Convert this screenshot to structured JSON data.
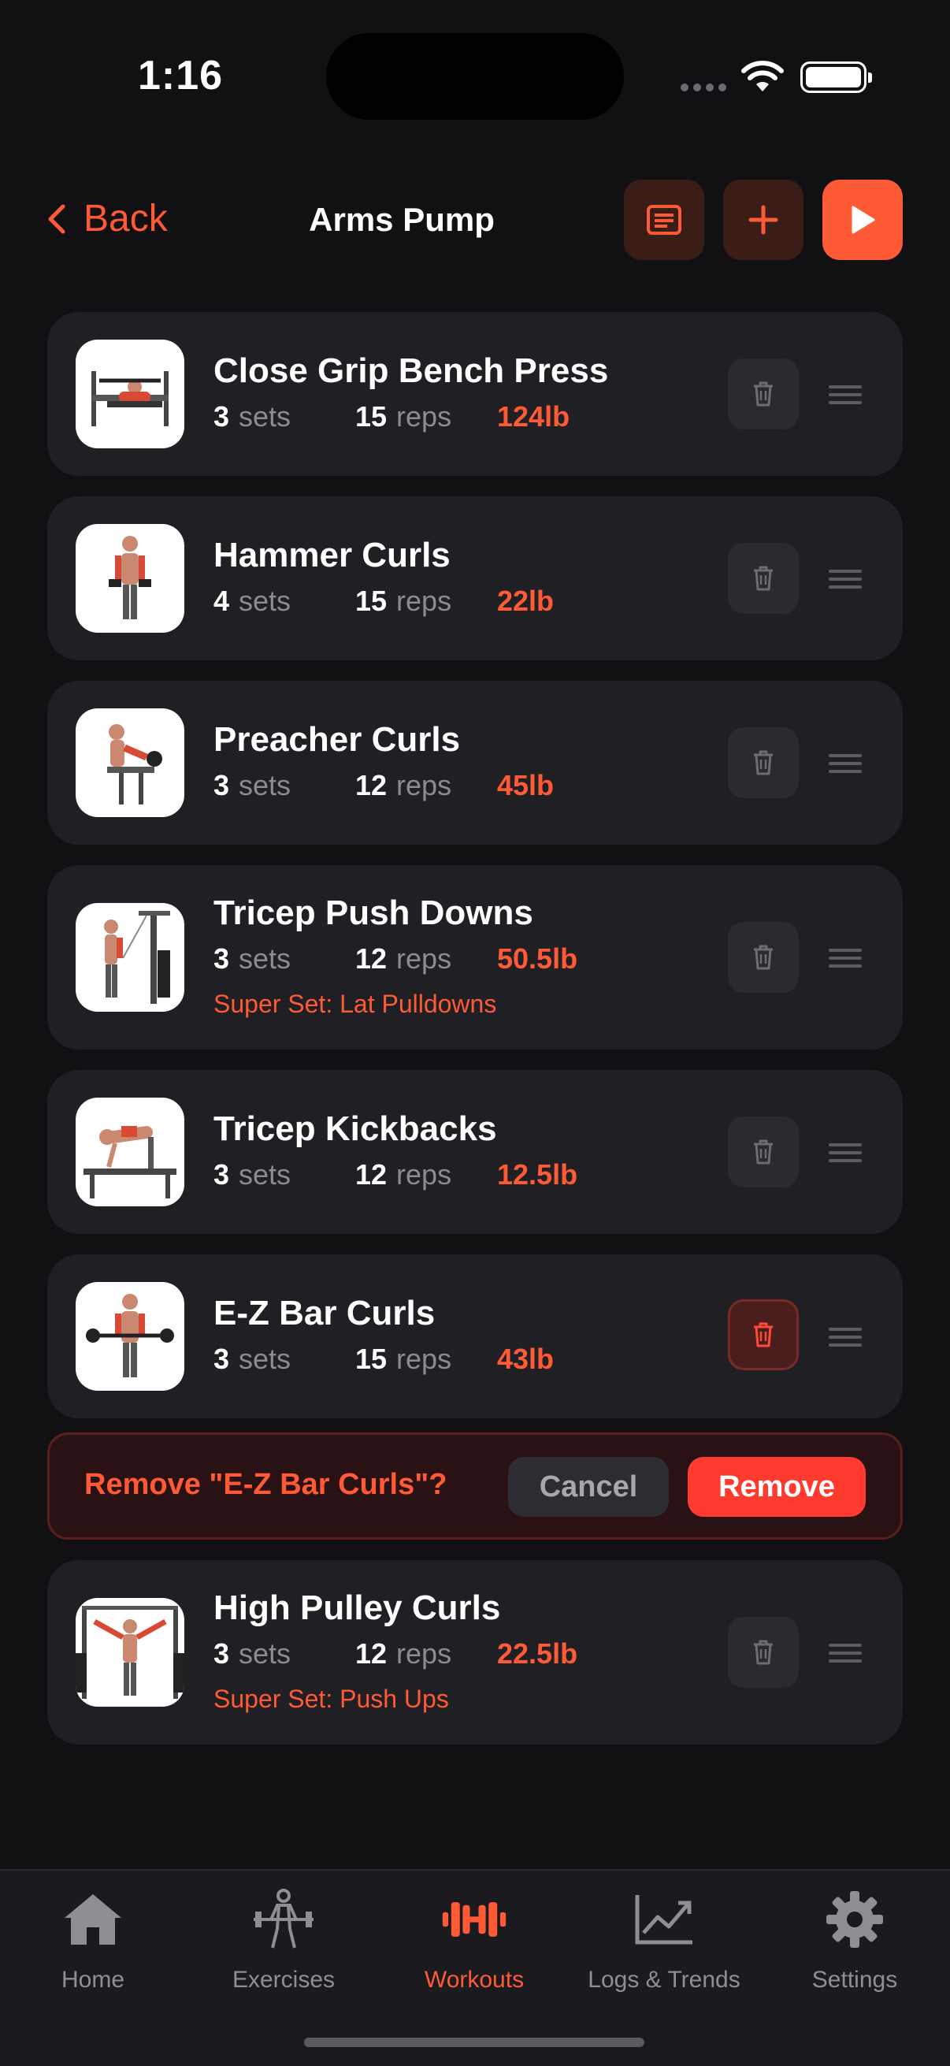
{
  "status_bar": {
    "time": "1:16"
  },
  "nav": {
    "back_label": "Back",
    "title": "Arms Pump",
    "notes_icon": "notes-icon",
    "add_icon": "plus-icon",
    "play_icon": "play-icon"
  },
  "labels": {
    "sets": "sets",
    "reps": "reps"
  },
  "exercises": [
    {
      "name": "Close Grip Bench Press",
      "sets": "3",
      "reps": "15",
      "weight": "124lb",
      "superset": ""
    },
    {
      "name": "Hammer Curls",
      "sets": "4",
      "reps": "15",
      "weight": "22lb",
      "superset": ""
    },
    {
      "name": "Preacher Curls",
      "sets": "3",
      "reps": "12",
      "weight": "45lb",
      "superset": ""
    },
    {
      "name": "Tricep Push Downs",
      "sets": "3",
      "reps": "12",
      "weight": "50.5lb",
      "superset": "Super Set: Lat Pulldowns"
    },
    {
      "name": "Tricep Kickbacks",
      "sets": "3",
      "reps": "12",
      "weight": "12.5lb",
      "superset": ""
    },
    {
      "name": "E-Z Bar Curls",
      "sets": "3",
      "reps": "15",
      "weight": "43lb",
      "superset": ""
    },
    {
      "name": "High Pulley Curls",
      "sets": "3",
      "reps": "12",
      "weight": "22.5lb",
      "superset": "Super Set: Push Ups"
    }
  ],
  "confirm": {
    "message": "Remove \"E-Z Bar Curls\"?",
    "cancel_label": "Cancel",
    "remove_label": "Remove"
  },
  "tabs": [
    {
      "label": "Home",
      "icon": "home-icon"
    },
    {
      "label": "Exercises",
      "icon": "weightlifter-icon"
    },
    {
      "label": "Workouts",
      "icon": "dumbbell-icon",
      "active": true
    },
    {
      "label": "Logs & Trends",
      "icon": "chart-icon"
    },
    {
      "label": "Settings",
      "icon": "gear-icon"
    }
  ],
  "colors": {
    "accent": "#ff5a36",
    "destructive": "#ff3b2f",
    "background": "#111114",
    "card": "#1f1f24"
  }
}
